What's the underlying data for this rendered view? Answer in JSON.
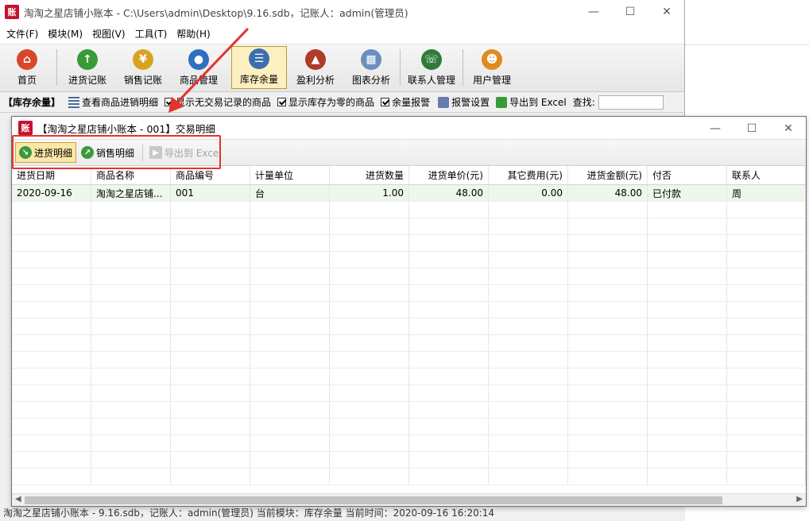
{
  "main_window": {
    "title": "淘淘之星店铺小账本 - C:\\Users\\admin\\Desktop\\9.16.sdb，记账人：admin(管理员)",
    "app_icon_text": "账"
  },
  "menu": [
    "文件(F)",
    "模块(M)",
    "视图(V)",
    "工具(T)",
    "帮助(H)"
  ],
  "toolbar": [
    {
      "label": "首页",
      "icon": "home-icon",
      "color": "#d9472b"
    },
    {
      "label": "进货记账",
      "icon": "purchase-icon",
      "color": "#3a9a3a"
    },
    {
      "label": "销售记账",
      "icon": "sales-icon",
      "color": "#d8a320"
    },
    {
      "label": "商品管理",
      "icon": "goods-icon",
      "color": "#2f6fbf"
    },
    {
      "label": "库存余量",
      "icon": "stock-icon",
      "color": "#3a6fb0"
    },
    {
      "label": "盈利分析",
      "icon": "profit-icon",
      "color": "#b23a2a"
    },
    {
      "label": "图表分析",
      "icon": "chart-icon",
      "color": "#6a8fbf"
    },
    {
      "label": "联系人管理",
      "icon": "contacts-icon",
      "color": "#2f7a3a"
    },
    {
      "label": "用户管理",
      "icon": "users-icon",
      "color": "#e08a20"
    }
  ],
  "subtoolbar": {
    "section": "【库存余量】",
    "view_detail": "查看商品进销明细",
    "show_no_trade": "显示无交易记录的商品",
    "show_zero_stock": "显示库存为零的商品",
    "stock_alert": "余量报警",
    "alert_settings": "报警设置",
    "export": "导出到 Excel",
    "search_label": "查找:"
  },
  "statusbar": "淘淘之星店铺小账本 - 9.16.sdb，记账人：admin(管理员)        当前模块：库存余量        当前时间：2020-09-16 16:20:14",
  "dialog": {
    "title": "【淘淘之星店铺小账本 - 001】交易明细",
    "buttons": {
      "purchase_detail": "进货明细",
      "sales_detail": "销售明细",
      "export": "导出到 Excel"
    },
    "columns": [
      "进货日期",
      "商品名称",
      "商品编号",
      "计量单位",
      "进货数量",
      "进货单价(元)",
      "其它费用(元)",
      "进货金额(元)",
      "付否",
      "联系人"
    ],
    "rows": [
      [
        "2020-09-16",
        "淘淘之星店铺...",
        "001",
        "台",
        "1.00",
        "48.00",
        "0.00",
        "48.00",
        "已付款",
        "周"
      ]
    ]
  },
  "colors": {
    "highlight_box": "#e5322d",
    "active_button_bg": "#fbe7a6",
    "selected_row_bg": "#eef7e9"
  }
}
